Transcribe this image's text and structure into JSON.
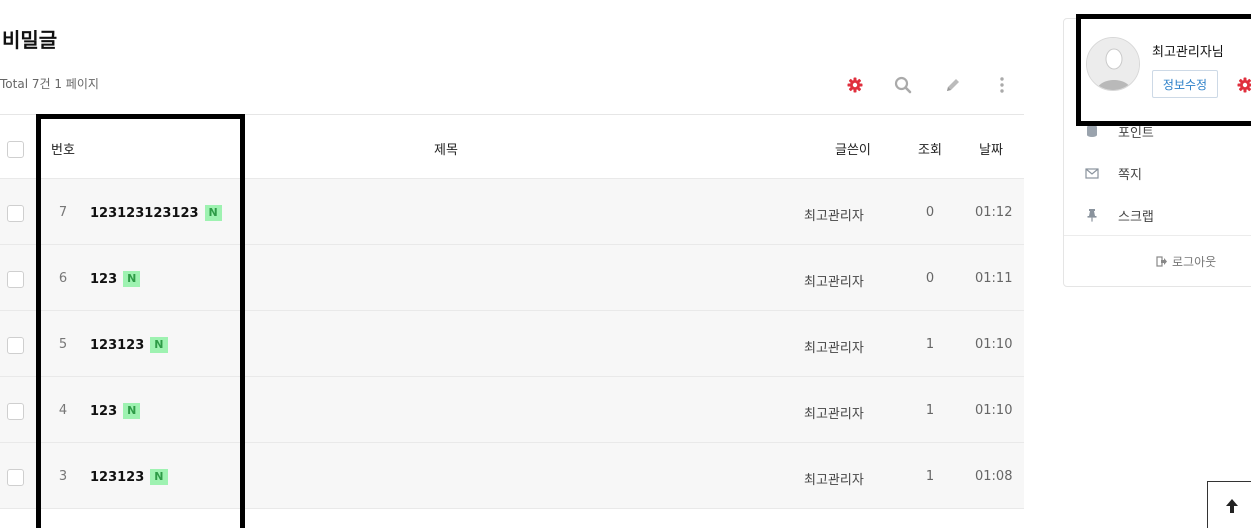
{
  "board": {
    "title": "비밀글",
    "total_text": "Total 7건 1 페이지"
  },
  "toolbar": {
    "icons": [
      "gear-icon",
      "search-icon",
      "pencil-icon",
      "more-vertical-icon"
    ],
    "accent_color": "#e0303e",
    "icon_color": "#aaaaaa"
  },
  "table": {
    "headers": {
      "num": "번호",
      "subject": "제목",
      "writer": "글쓴이",
      "views": "조회",
      "date": "날짜"
    },
    "new_badge": "N",
    "rows": [
      {
        "num": "7",
        "subject": "123123123123",
        "writer": "최고관리자",
        "views": "0",
        "date": "01:12"
      },
      {
        "num": "6",
        "subject": "123",
        "writer": "최고관리자",
        "views": "0",
        "date": "01:11"
      },
      {
        "num": "5",
        "subject": "123123",
        "writer": "최고관리자",
        "views": "1",
        "date": "01:10"
      },
      {
        "num": "4",
        "subject": "123",
        "writer": "최고관리자",
        "views": "1",
        "date": "01:10"
      },
      {
        "num": "3",
        "subject": "123123",
        "writer": "최고관리자",
        "views": "1",
        "date": "01:08"
      }
    ]
  },
  "sidebar": {
    "user_name": "최고관리자님",
    "edit_button": "정보수정",
    "menu": [
      {
        "icon": "database-icon",
        "label": "포인트"
      },
      {
        "icon": "envelope-icon",
        "label": "쪽지"
      },
      {
        "icon": "pin-icon",
        "label": "스크랩"
      }
    ],
    "logout": "로그아웃"
  },
  "scroll_top_icon": "arrow-up-icon"
}
